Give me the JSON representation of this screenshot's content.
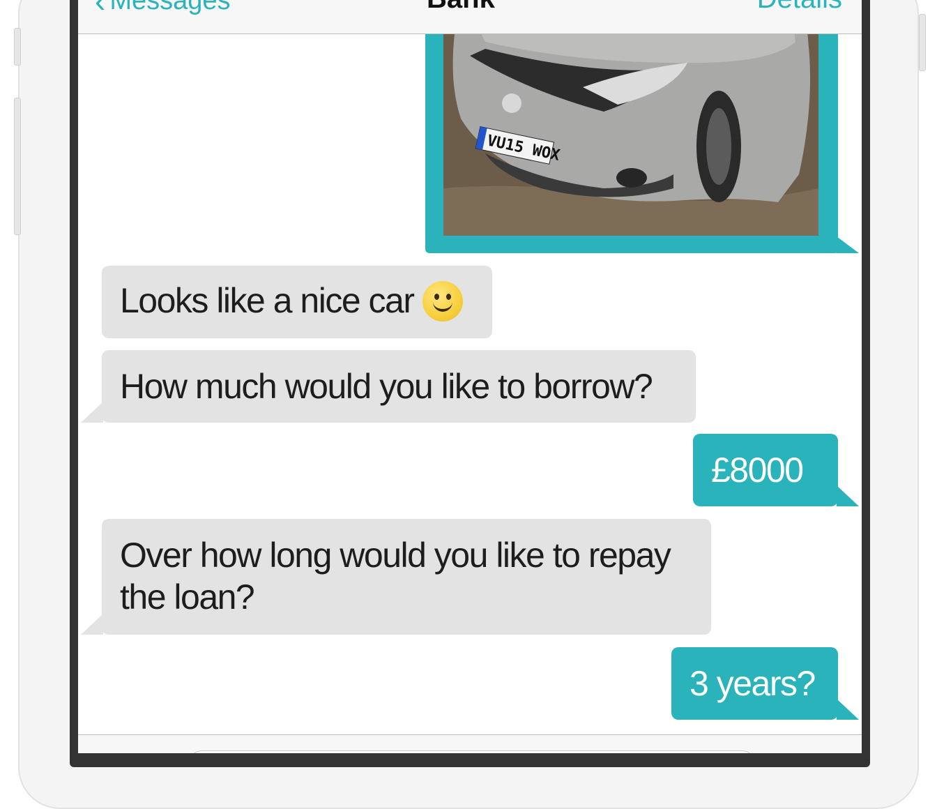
{
  "nav": {
    "back_label": "Messages",
    "title": "Bank",
    "details_label": "Details"
  },
  "colors": {
    "accent": "#2ab3ba",
    "incoming_bubble": "#e3e3e3"
  },
  "messages": [
    {
      "direction": "outgoing",
      "type": "image",
      "image_description": "Silver hatchback car",
      "plate": "VU15 WOX"
    },
    {
      "direction": "incoming",
      "text": "Looks like a nice car",
      "emoji": "smiley-face"
    },
    {
      "direction": "incoming",
      "text": "How much would you like to borrow?"
    },
    {
      "direction": "outgoing",
      "text": "£8000"
    },
    {
      "direction": "incoming",
      "text": "Over how long would you like to repay the loan?"
    },
    {
      "direction": "outgoing",
      "text": "3 years?"
    }
  ]
}
